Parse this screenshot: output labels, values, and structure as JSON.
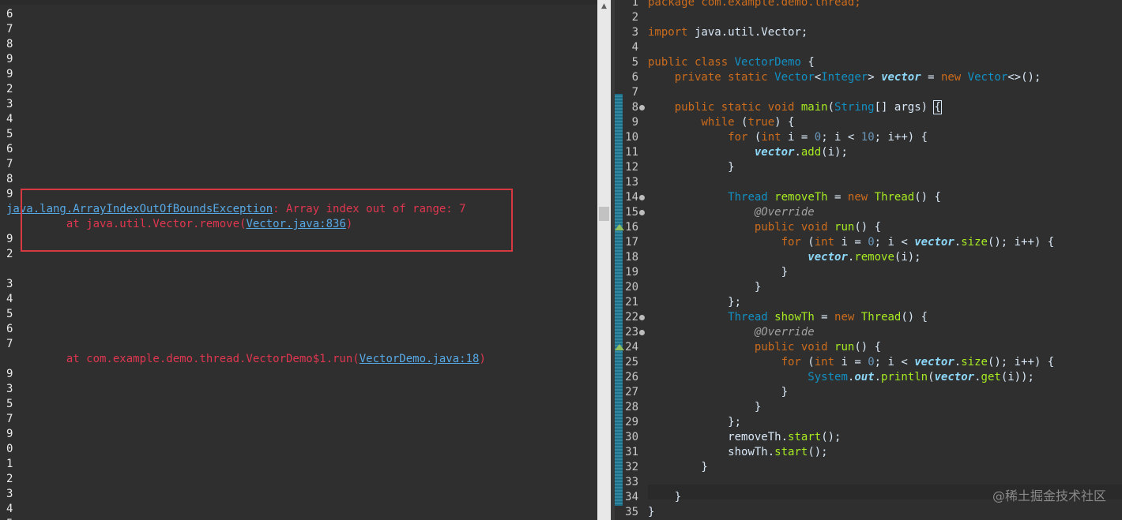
{
  "console": {
    "lines": [
      {
        "t": "6"
      },
      {
        "t": "7"
      },
      {
        "t": "8"
      },
      {
        "t": "9"
      },
      {
        "t": "9"
      },
      {
        "t": "2"
      },
      {
        "t": "3"
      },
      {
        "t": "4"
      },
      {
        "t": "5"
      },
      {
        "t": "6"
      },
      {
        "t": "7"
      },
      {
        "t": "8"
      },
      {
        "t": "9"
      },
      {
        "parts": [
          {
            "text": "java.lang.ArrayIndexOutOfBoundsException",
            "cls": "lnk"
          },
          {
            "text": ": Array index out of range: 7",
            "cls": "err"
          }
        ]
      },
      {
        "parts": [
          {
            "text": "         at java.util.Vector.remove(",
            "cls": "err"
          },
          {
            "text": "Vector.java:836",
            "cls": "lnk"
          },
          {
            "text": ")",
            "cls": "err"
          }
        ]
      },
      {
        "t": "9"
      },
      {
        "t": "2"
      },
      {
        "t": ""
      },
      {
        "t": "3"
      },
      {
        "t": "4"
      },
      {
        "t": "5"
      },
      {
        "t": "6"
      },
      {
        "t": "7"
      },
      {
        "parts": [
          {
            "text": "         at com.example.demo.thread.VectorDemo$1.run(",
            "cls": "err"
          },
          {
            "text": "VectorDemo.java:18",
            "cls": "lnk"
          },
          {
            "text": ")",
            "cls": "err"
          }
        ]
      },
      {
        "t": "9"
      },
      {
        "t": "3"
      },
      {
        "t": "5"
      },
      {
        "t": "7"
      },
      {
        "t": "9"
      },
      {
        "t": "0"
      },
      {
        "t": "1"
      },
      {
        "t": "2"
      },
      {
        "t": "3"
      },
      {
        "t": "4"
      },
      {
        "t": "5"
      }
    ]
  },
  "editor": {
    "lines": [
      {
        "n": "1",
        "parts": [
          {
            "t": "package com.example.demo.thread;",
            "c": "kw"
          }
        ]
      },
      {
        "n": "2",
        "parts": []
      },
      {
        "n": "3",
        "parts": [
          {
            "t": "import",
            "c": "kw"
          },
          {
            "t": " java.util.Vector;"
          }
        ]
      },
      {
        "n": "4",
        "parts": []
      },
      {
        "n": "5",
        "parts": [
          {
            "t": "public class",
            "c": "kw"
          },
          {
            "t": " "
          },
          {
            "t": "VectorDemo",
            "c": "ty"
          },
          {
            "t": " {"
          }
        ]
      },
      {
        "n": "6",
        "parts": [
          {
            "t": "    "
          },
          {
            "t": "private static",
            "c": "kw"
          },
          {
            "t": " "
          },
          {
            "t": "Vector",
            "c": "ty"
          },
          {
            "t": "<"
          },
          {
            "t": "Integer",
            "c": "ty"
          },
          {
            "t": "> "
          },
          {
            "t": "vector",
            "c": "sfld"
          },
          {
            "t": " = "
          },
          {
            "t": "new",
            "c": "kw"
          },
          {
            "t": " "
          },
          {
            "t": "Vector",
            "c": "ty"
          },
          {
            "t": "<>();"
          }
        ]
      },
      {
        "n": "7",
        "parts": []
      },
      {
        "n": "8",
        "fold": true,
        "parts": [
          {
            "t": "    "
          },
          {
            "t": "public static void",
            "c": "kw"
          },
          {
            "t": " "
          },
          {
            "t": "main",
            "c": "mth"
          },
          {
            "t": "("
          },
          {
            "t": "String",
            "c": "ty"
          },
          {
            "t": "[] "
          },
          {
            "t": "args",
            "c": "ident"
          },
          {
            "t": ") "
          },
          {
            "t": "{",
            "c": "bracket"
          }
        ]
      },
      {
        "n": "9",
        "parts": [
          {
            "t": "        "
          },
          {
            "t": "while",
            "c": "kw"
          },
          {
            "t": " ("
          },
          {
            "t": "true",
            "c": "kw"
          },
          {
            "t": ") {"
          }
        ]
      },
      {
        "n": "10",
        "parts": [
          {
            "t": "            "
          },
          {
            "t": "for",
            "c": "kw"
          },
          {
            "t": " ("
          },
          {
            "t": "int",
            "c": "kw"
          },
          {
            "t": " i = "
          },
          {
            "t": "0",
            "c": "num"
          },
          {
            "t": "; i < "
          },
          {
            "t": "10",
            "c": "num"
          },
          {
            "t": "; i++) {"
          }
        ]
      },
      {
        "n": "11",
        "parts": [
          {
            "t": "                "
          },
          {
            "t": "vector",
            "c": "sfld"
          },
          {
            "t": "."
          },
          {
            "t": "add",
            "c": "mth"
          },
          {
            "t": "(i);"
          }
        ]
      },
      {
        "n": "12",
        "parts": [
          {
            "t": "            }"
          }
        ]
      },
      {
        "n": "13",
        "parts": []
      },
      {
        "n": "14",
        "fold": true,
        "parts": [
          {
            "t": "            "
          },
          {
            "t": "Thread",
            "c": "ty"
          },
          {
            "t": " "
          },
          {
            "t": "removeTh",
            "c": "mth"
          },
          {
            "t": " = "
          },
          {
            "t": "new",
            "c": "kw"
          },
          {
            "t": " "
          },
          {
            "t": "Thread",
            "c": "mth"
          },
          {
            "t": "() {"
          }
        ]
      },
      {
        "n": "15",
        "fold": true,
        "parts": [
          {
            "t": "                "
          },
          {
            "t": "@Override",
            "c": "ann"
          }
        ]
      },
      {
        "n": "16",
        "ovr": true,
        "parts": [
          {
            "t": "                "
          },
          {
            "t": "public void",
            "c": "kw"
          },
          {
            "t": " "
          },
          {
            "t": "run",
            "c": "mth"
          },
          {
            "t": "() {"
          }
        ]
      },
      {
        "n": "17",
        "parts": [
          {
            "t": "                    "
          },
          {
            "t": "for",
            "c": "kw"
          },
          {
            "t": " ("
          },
          {
            "t": "int",
            "c": "kw"
          },
          {
            "t": " i = "
          },
          {
            "t": "0",
            "c": "num"
          },
          {
            "t": "; i < "
          },
          {
            "t": "vector",
            "c": "sfld"
          },
          {
            "t": "."
          },
          {
            "t": "size",
            "c": "mth"
          },
          {
            "t": "(); i++) {"
          }
        ]
      },
      {
        "n": "18",
        "parts": [
          {
            "t": "                        "
          },
          {
            "t": "vector",
            "c": "sfld"
          },
          {
            "t": "."
          },
          {
            "t": "remove",
            "c": "mth"
          },
          {
            "t": "(i);"
          }
        ]
      },
      {
        "n": "19",
        "parts": [
          {
            "t": "                    }"
          }
        ]
      },
      {
        "n": "20",
        "parts": [
          {
            "t": "                }"
          }
        ]
      },
      {
        "n": "21",
        "parts": [
          {
            "t": "            };"
          }
        ]
      },
      {
        "n": "22",
        "fold": true,
        "parts": [
          {
            "t": "            "
          },
          {
            "t": "Thread",
            "c": "ty"
          },
          {
            "t": " "
          },
          {
            "t": "showTh",
            "c": "mth"
          },
          {
            "t": " = "
          },
          {
            "t": "new",
            "c": "kw"
          },
          {
            "t": " "
          },
          {
            "t": "Thread",
            "c": "mth"
          },
          {
            "t": "() {"
          }
        ]
      },
      {
        "n": "23",
        "fold": true,
        "parts": [
          {
            "t": "                "
          },
          {
            "t": "@Override",
            "c": "ann"
          }
        ]
      },
      {
        "n": "24",
        "ovr": true,
        "parts": [
          {
            "t": "                "
          },
          {
            "t": "public void",
            "c": "kw"
          },
          {
            "t": " "
          },
          {
            "t": "run",
            "c": "mth"
          },
          {
            "t": "() {"
          }
        ]
      },
      {
        "n": "25",
        "parts": [
          {
            "t": "                    "
          },
          {
            "t": "for",
            "c": "kw"
          },
          {
            "t": " ("
          },
          {
            "t": "int",
            "c": "kw"
          },
          {
            "t": " i = "
          },
          {
            "t": "0",
            "c": "num"
          },
          {
            "t": "; i < "
          },
          {
            "t": "vector",
            "c": "sfld"
          },
          {
            "t": "."
          },
          {
            "t": "size",
            "c": "mth"
          },
          {
            "t": "(); i++) {"
          }
        ]
      },
      {
        "n": "26",
        "parts": [
          {
            "t": "                        "
          },
          {
            "t": "System",
            "c": "ty"
          },
          {
            "t": "."
          },
          {
            "t": "out",
            "c": "sfld"
          },
          {
            "t": "."
          },
          {
            "t": "println",
            "c": "mth"
          },
          {
            "t": "("
          },
          {
            "t": "vector",
            "c": "sfld"
          },
          {
            "t": "."
          },
          {
            "t": "get",
            "c": "mth"
          },
          {
            "t": "(i));"
          }
        ]
      },
      {
        "n": "27",
        "parts": [
          {
            "t": "                    }"
          }
        ]
      },
      {
        "n": "28",
        "parts": [
          {
            "t": "                }"
          }
        ]
      },
      {
        "n": "29",
        "parts": [
          {
            "t": "            };"
          }
        ]
      },
      {
        "n": "30",
        "parts": [
          {
            "t": "            "
          },
          {
            "t": "removeTh",
            "c": "ident"
          },
          {
            "t": "."
          },
          {
            "t": "start",
            "c": "mth"
          },
          {
            "t": "();"
          }
        ]
      },
      {
        "n": "31",
        "parts": [
          {
            "t": "            "
          },
          {
            "t": "showTh",
            "c": "ident"
          },
          {
            "t": "."
          },
          {
            "t": "start",
            "c": "mth"
          },
          {
            "t": "();"
          }
        ]
      },
      {
        "n": "32",
        "parts": [
          {
            "t": "        }"
          }
        ]
      },
      {
        "n": "33",
        "parts": []
      },
      {
        "n": "34",
        "parts": [
          {
            "t": "    }"
          }
        ]
      },
      {
        "n": "35",
        "parts": [
          {
            "t": "}"
          }
        ]
      }
    ]
  },
  "watermark": "@稀土掘金技术社区",
  "colors": {
    "error": "#e0364f",
    "link": "#57a9e6",
    "highlight_box": "#d6393f",
    "keyword": "#cc6c1d",
    "type": "#1290c3",
    "method": "#a7ec21"
  }
}
